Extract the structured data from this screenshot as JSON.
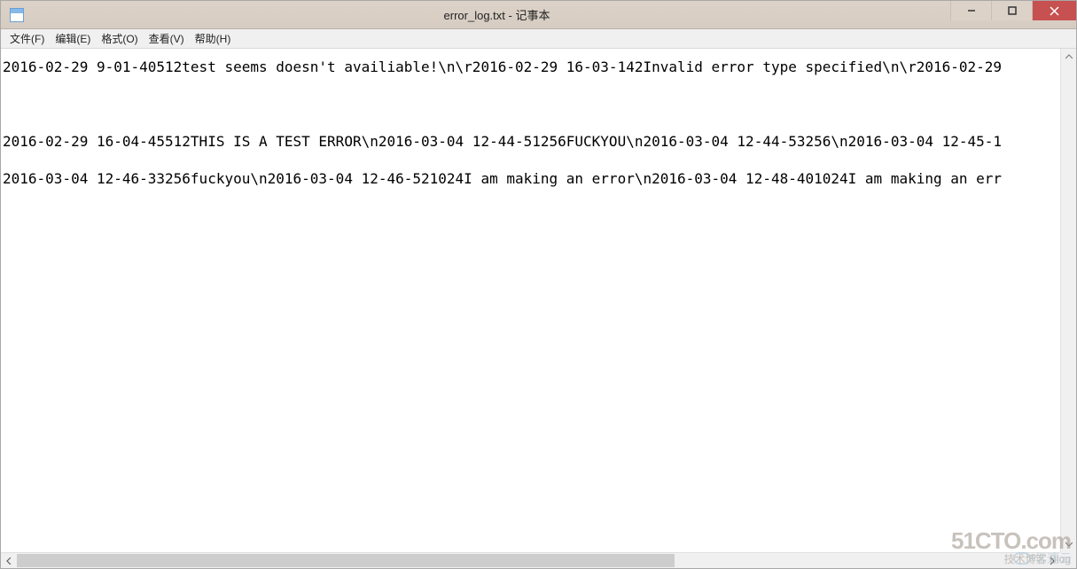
{
  "window": {
    "title": "error_log.txt - 记事本"
  },
  "menu": {
    "file": "文件(F)",
    "edit": "编辑(E)",
    "format": "格式(O)",
    "view": "查看(V)",
    "help": "帮助(H)"
  },
  "content": {
    "line1": "2016-02-29 9-01-40512test seems doesn't availiable!\\n\\r2016-02-29 16-03-142Invalid error type specified\\n\\r2016-02-29 ",
    "line2": "",
    "line3": "2016-02-29 16-04-45512THIS IS A TEST ERROR\\n2016-03-04 12-44-51256FUCKYOU\\n2016-03-04 12-44-53256\\n2016-03-04 12-45-1",
    "line4": "2016-03-04 12-46-33256fuckyou\\n2016-03-04 12-46-521024I am making an error\\n2016-03-04 12-48-401024I am making an err"
  },
  "watermark": {
    "main": "51CTO.com",
    "sub": "技术博客   Blog",
    "second": "亿速云"
  }
}
